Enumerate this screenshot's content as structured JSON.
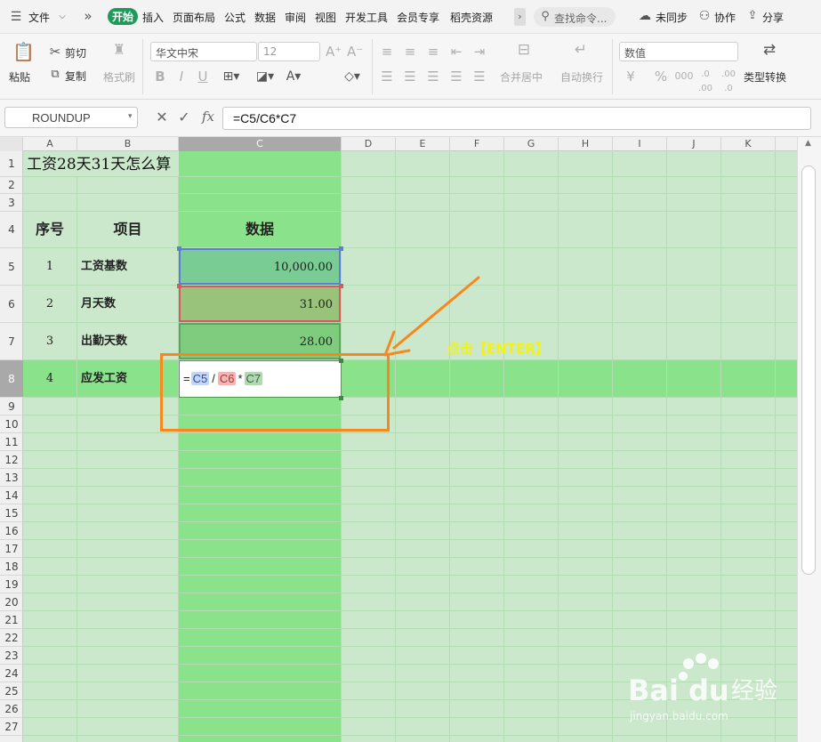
{
  "menubar": {
    "file": "文件",
    "tabs": [
      "开始",
      "插入",
      "页面布局",
      "公式",
      "数据",
      "审阅",
      "视图",
      "开发工具",
      "会员专享",
      "稻壳资源"
    ],
    "search_placeholder": "查找命令...",
    "unsync": "未同步",
    "collab": "协作",
    "share": "分享"
  },
  "ribbon": {
    "paste": "粘贴",
    "cut": "剪切",
    "copy": "复制",
    "format_painter": "格式刷",
    "font_name": "华文中宋",
    "font_size": "12",
    "merge_center": "合并居中",
    "wrap_text": "自动换行",
    "number_format": "数值",
    "type_convert": "类型转换"
  },
  "formula_bar": {
    "name_box": "ROUNDUP",
    "formula": "=C5/C6*C7"
  },
  "columns": [
    "A",
    "B",
    "C",
    "D",
    "E",
    "F",
    "G",
    "H",
    "I",
    "J",
    "K"
  ],
  "rows": [
    "1",
    "2",
    "3",
    "4",
    "5",
    "6",
    "7",
    "8",
    "9",
    "10",
    "11",
    "12",
    "13",
    "14",
    "15",
    "16",
    "17",
    "18",
    "19",
    "20",
    "21",
    "22",
    "23",
    "24",
    "25",
    "26",
    "27"
  ],
  "sheet": {
    "title": "工资28天31天怎么算",
    "headers": {
      "a": "序号",
      "b": "项目",
      "c": "数据"
    },
    "data_rows": [
      {
        "no": "1",
        "item": "工资基数",
        "value": "10,000.00"
      },
      {
        "no": "2",
        "item": "月天数",
        "value": "31.00"
      },
      {
        "no": "3",
        "item": "出勤天数",
        "value": "28.00"
      },
      {
        "no": "4",
        "item": "应发工资"
      }
    ],
    "editing_formula": {
      "eq": "=",
      "r1": "C5",
      "op1": "/",
      "r2": "C6",
      "op2": "*",
      "r3": "C7"
    }
  },
  "annotation": {
    "text": "点击【ENTER】"
  },
  "colors": {
    "sheet_bg": "#cce8cc",
    "col_c": "#8ae38a",
    "row8": "#8ae38a",
    "header_bar": "#1f9a5a",
    "orange": "#f5891f",
    "ref_c5": "#c5d6f5",
    "ref_c6": "#f1b6b6",
    "ref_c7": "#b4d6b4"
  },
  "watermark": {
    "brand": "Baidu经验",
    "url": "jingyan.baidu.com"
  }
}
